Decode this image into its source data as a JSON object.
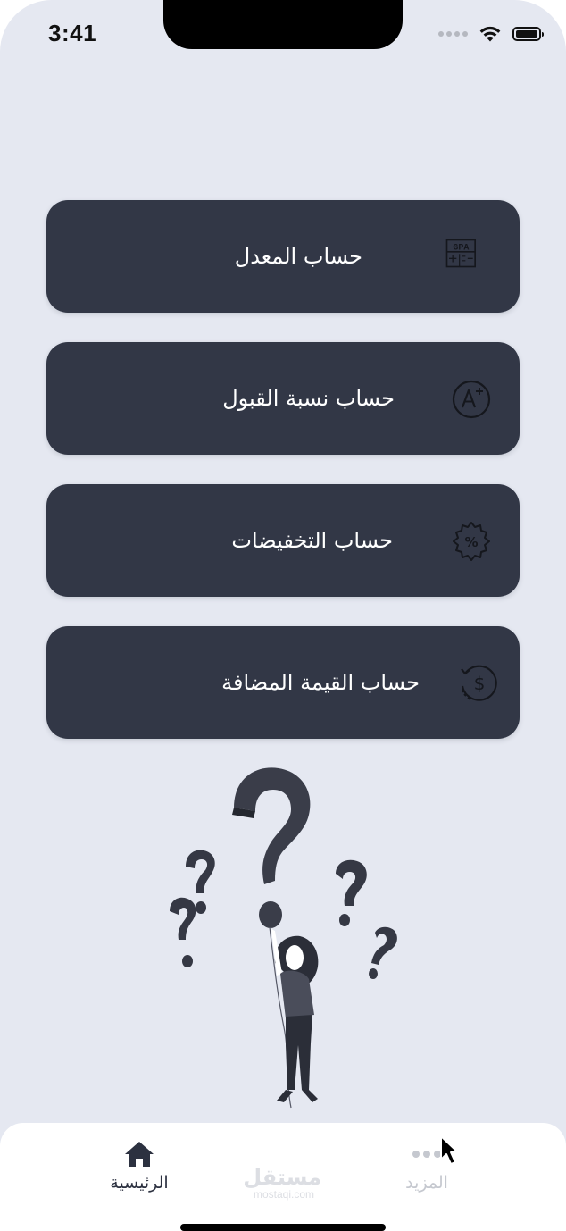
{
  "status_bar": {
    "time": "3:41"
  },
  "menu": {
    "items": [
      {
        "label": "حساب المعدل",
        "icon": "gpa-calculator-icon",
        "icon_text": "GPA"
      },
      {
        "label": "حساب نسبة القبول",
        "icon": "a-plus-grade-icon"
      },
      {
        "label": "حساب التخفيضات",
        "icon": "discount-percent-badge-icon"
      },
      {
        "label": "حساب القيمة المضافة",
        "icon": "dollar-refresh-icon"
      }
    ]
  },
  "tabbar": {
    "home": {
      "label": "الرئيسية",
      "icon": "home-icon",
      "active": true
    },
    "more": {
      "label": "المزيد",
      "icon": "more-dots-icon",
      "active": false
    }
  },
  "watermark": {
    "main": "مستقل",
    "sub": "mostaqi.com"
  },
  "colors": {
    "background": "#e5e8f1",
    "card": "#323746",
    "card_text": "#ffffff",
    "tab_active": "#2c3140",
    "tab_inactive": "#c5c8cf"
  }
}
